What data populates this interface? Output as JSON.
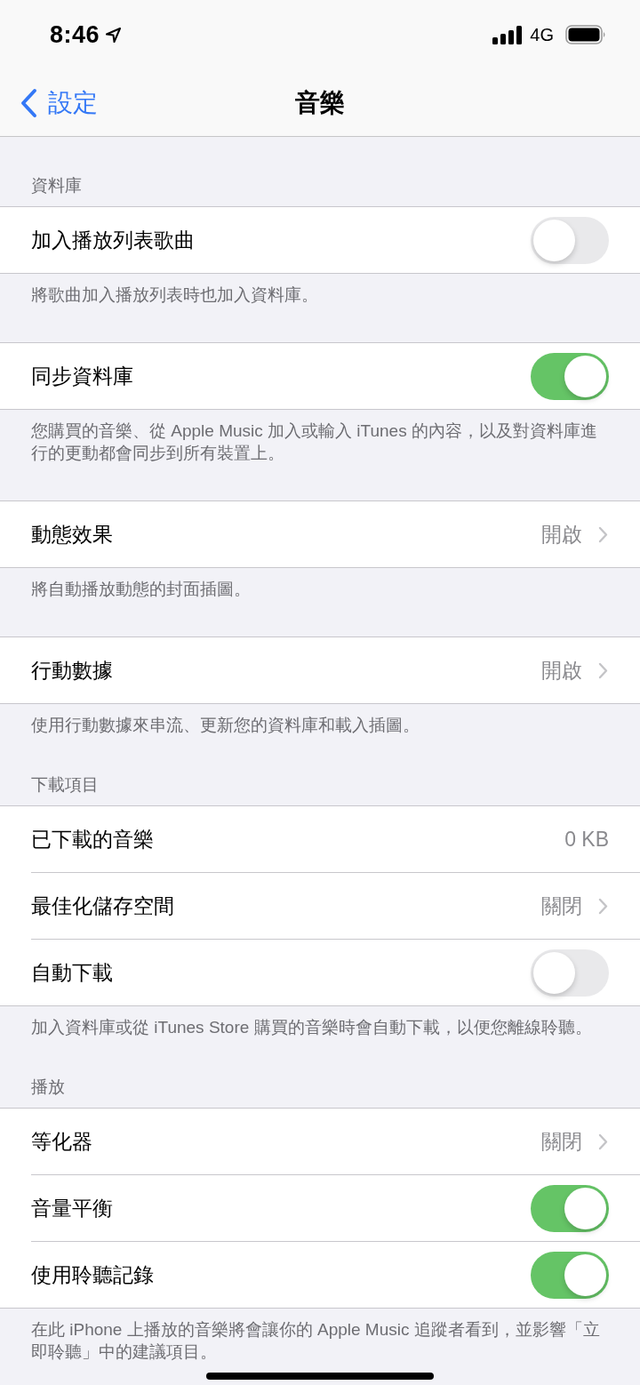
{
  "status_bar": {
    "time": "8:46",
    "network": "4G"
  },
  "nav_bar": {
    "back_label": "設定",
    "title": "音樂"
  },
  "sections": [
    {
      "header": "資料庫",
      "rows": [
        {
          "kind": "toggle",
          "label": "加入播放列表歌曲",
          "on": false
        }
      ],
      "footer": "將歌曲加入播放列表時也加入資料庫。"
    },
    {
      "rows": [
        {
          "kind": "toggle",
          "label": "同步資料庫",
          "on": true
        }
      ],
      "footer": "您購買的音樂、從 Apple Music 加入或輸入 iTunes 的內容，以及對資料庫進行的更動都會同步到所有裝置上。"
    },
    {
      "rows": [
        {
          "kind": "link",
          "label": "動態效果",
          "value": "開啟"
        }
      ],
      "footer": "將自動播放動態的封面插圖。"
    },
    {
      "rows": [
        {
          "kind": "link",
          "label": "行動數據",
          "value": "開啟"
        }
      ],
      "footer": "使用行動數據來串流、更新您的資料庫和載入插圖。"
    },
    {
      "header": "下載項目",
      "rows": [
        {
          "kind": "info",
          "label": "已下載的音樂",
          "value": "0 KB"
        },
        {
          "kind": "link",
          "label": "最佳化儲存空間",
          "value": "關閉"
        },
        {
          "kind": "toggle",
          "label": "自動下載",
          "on": false
        }
      ],
      "footer": "加入資料庫或從 iTunes Store 購買的音樂時會自動下載，以便您離線聆聽。"
    },
    {
      "header": "播放",
      "rows": [
        {
          "kind": "link",
          "label": "等化器",
          "value": "關閉"
        },
        {
          "kind": "toggle",
          "label": "音量平衡",
          "on": true
        },
        {
          "kind": "toggle",
          "label": "使用聆聽記錄",
          "on": true
        }
      ],
      "footer": "在此 iPhone 上播放的音樂將會讓你的 Apple Music 追蹤者看到，並影響「立即聆聽」中的建議項目。"
    }
  ]
}
